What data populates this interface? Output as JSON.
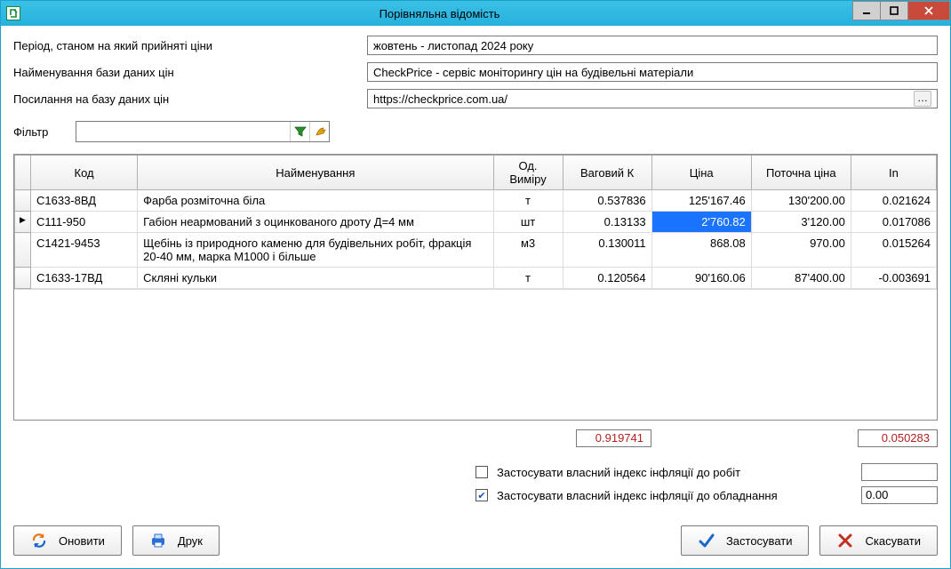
{
  "window": {
    "title": "Порівняльна відомість"
  },
  "form": {
    "period_label": "Період, станом на який прийняті ціни",
    "period_value": "жовтень - листопад 2024 року",
    "dbname_label": "Найменування бази даних цін",
    "dbname_value": "CheckPrice - сервіс моніторингу цін на будівельні матеріали",
    "dblink_label": "Посилання на базу даних цін",
    "dblink_value": "https://checkprice.com.ua/"
  },
  "filter": {
    "label": "Фільтр",
    "value": ""
  },
  "grid": {
    "columns": {
      "code": "Код",
      "name": "Найменування",
      "unit": "Од. Виміру",
      "wk": "Ваговий К",
      "price": "Ціна",
      "cprice": "Поточна ціна",
      "in": "In"
    },
    "rows": [
      {
        "code": "С1633-8ВД",
        "name": "Фарба розміточна біла",
        "unit": "т",
        "wk": "0.537836",
        "price": "125'167.46",
        "cprice": "130'200.00",
        "in": "0.021624",
        "current": false
      },
      {
        "code": "С111-950",
        "name": "Габіон неармований з оцинкованого дроту Д=4 мм",
        "unit": "шт",
        "wk": "0.13133",
        "price": "2'760.82",
        "cprice": "3'120.00",
        "in": "0.017086",
        "current": true
      },
      {
        "code": "С1421-9453",
        "name": "Щебінь із природного каменю для будівельних робіт, фракція 20-40 мм, марка М1000 і більше",
        "unit": "м3",
        "wk": "0.130011",
        "price": "868.08",
        "cprice": "970.00",
        "in": "0.015264",
        "current": false
      },
      {
        "code": "С1633-17ВД",
        "name": "Скляні кульки",
        "unit": "т",
        "wk": "0.120564",
        "price": "90'160.06",
        "cprice": "87'400.00",
        "in": "-0.003691",
        "current": false
      }
    ]
  },
  "totals": {
    "wk_sum": "0.919741",
    "in_sum": "0.050283"
  },
  "options": {
    "works_label": "Застосувати власний індекс інфляції до робіт",
    "works_checked": false,
    "works_value": "",
    "equip_label": "Застосувати власний індекс інфляції до обладнання",
    "equip_checked": true,
    "equip_value": "0.00"
  },
  "buttons": {
    "refresh": "Оновити",
    "print": "Друк",
    "apply": "Застосувати",
    "cancel": "Скасувати"
  }
}
